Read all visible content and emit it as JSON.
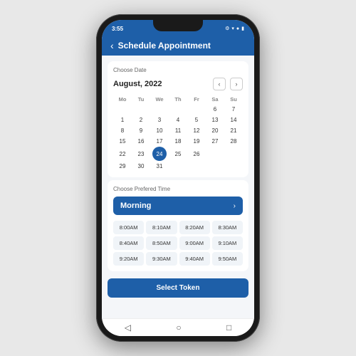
{
  "phone": {
    "status_bar": {
      "time": "3:55",
      "icons": [
        "⚙",
        "▼",
        "●",
        "▮▮▮"
      ]
    },
    "header": {
      "back_label": "‹",
      "title": "Schedule Appointment"
    },
    "calendar": {
      "section_label": "Choose Date",
      "month": "August, 2022",
      "nav_prev": "‹",
      "nav_next": "›",
      "day_headers": [
        "Mo",
        "Tu",
        "We",
        "Th",
        "Fr",
        "Sa",
        "Su"
      ],
      "weeks": [
        [
          "",
          "",
          "",
          "",
          "",
          "",
          ""
        ],
        [
          "1",
          "2",
          "3",
          "4",
          "5",
          "6",
          "7"
        ],
        [
          "8",
          "9",
          "10",
          "11",
          "12",
          "13",
          "14"
        ],
        [
          "15",
          "16",
          "17",
          "18",
          "19",
          "20",
          "21"
        ],
        [
          "22",
          "23",
          "24",
          "25",
          "26",
          "27",
          "28"
        ],
        [
          "29",
          "30",
          "31",
          "",
          "",
          "",
          ""
        ]
      ],
      "selected_date": "24"
    },
    "time": {
      "section_label": "Choose Prefered Time",
      "selector_label": "Morning",
      "selector_arrow": "›",
      "slots": [
        "8:00AM",
        "8:10AM",
        "8:20AM",
        "8:30AM",
        "8:40AM",
        "8:50AM",
        "9:00AM",
        "9:10AM",
        "9:20AM",
        "9:30AM",
        "9:40AM",
        "9:50AM"
      ]
    },
    "bottom_button": {
      "label": "Select Token"
    },
    "bottom_nav": {
      "icons": [
        "◁",
        "○",
        "□"
      ]
    }
  }
}
